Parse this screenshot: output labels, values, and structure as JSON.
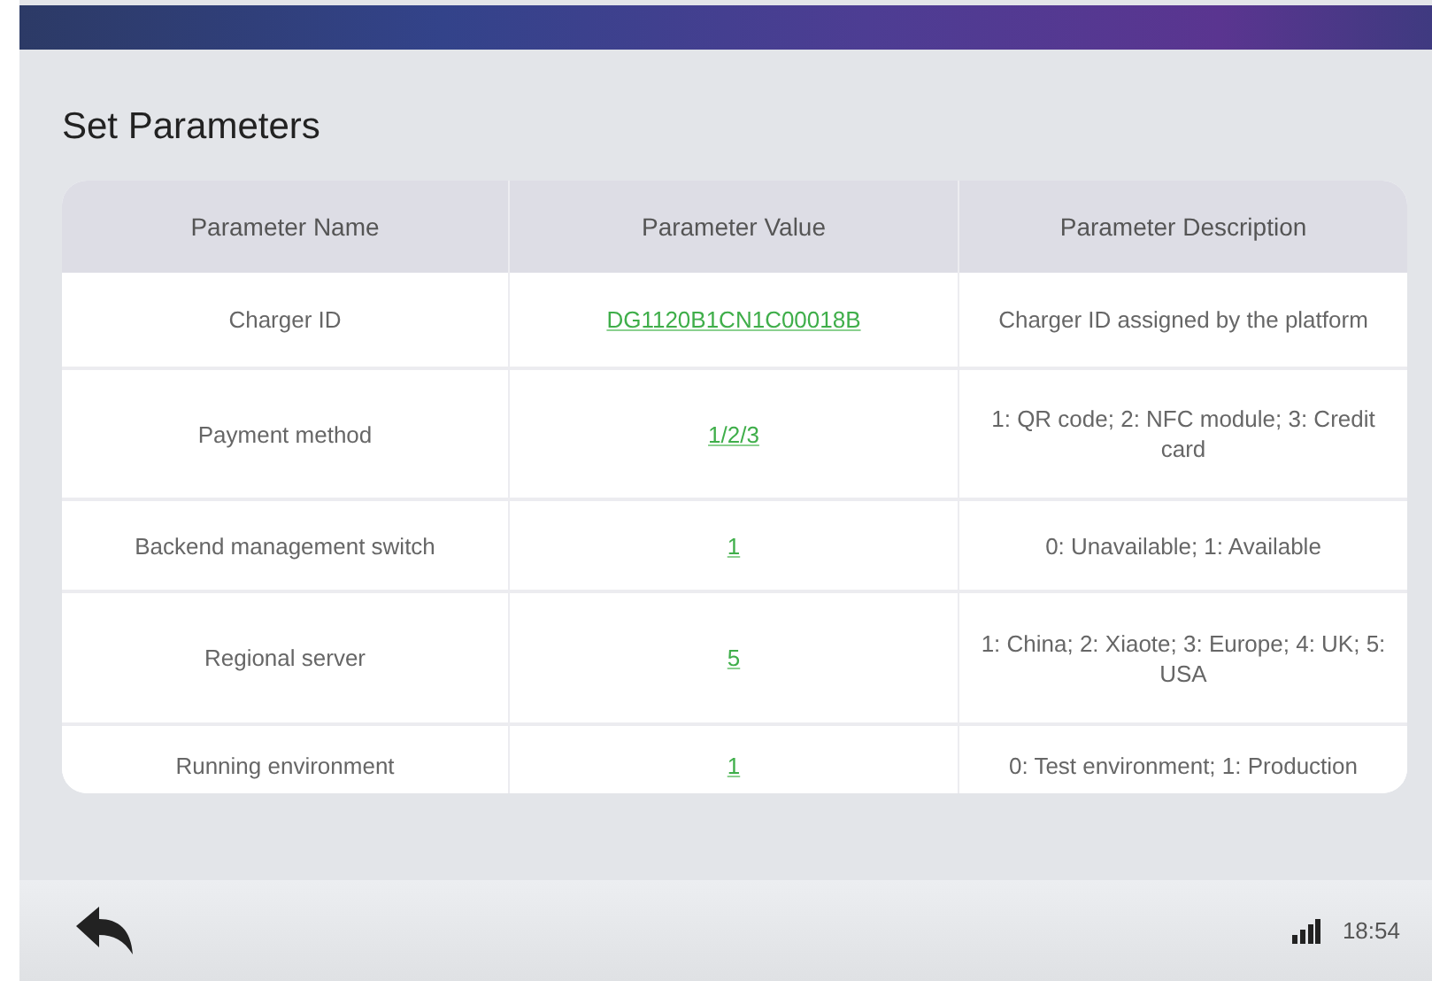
{
  "title": "Set Parameters",
  "table": {
    "columns": [
      "Parameter Name",
      "Parameter Value",
      "Parameter Description"
    ],
    "rows": [
      {
        "name": "Charger ID",
        "value": "DG1120B1CN1C00018B",
        "description": "Charger ID assigned by the platform"
      },
      {
        "name": "Payment method",
        "value": "1/2/3",
        "description": "1: QR code; 2: NFC module; 3: Credit card"
      },
      {
        "name": "Backend management switch",
        "value": "1",
        "description": "0: Unavailable; 1: Available"
      },
      {
        "name": "Regional server",
        "value": "5",
        "description": "1: China; 2: Xiaote; 3: Europe; 4: UK; 5: USA"
      },
      {
        "name": "Running environment",
        "value": "1",
        "description": "0: Test environment; 1: Production"
      }
    ]
  },
  "status_bar": {
    "time": "18:54"
  }
}
